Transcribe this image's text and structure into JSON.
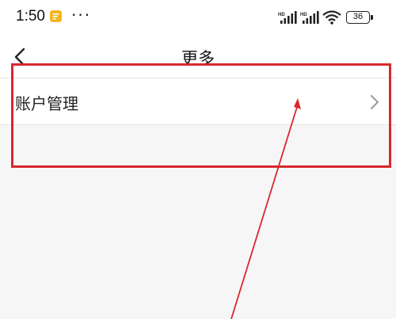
{
  "status_bar": {
    "time": "1:50",
    "battery_level": "36",
    "icons": [
      "app-notification-icon",
      "more-dots-icon",
      "hd-signal-icon",
      "hd-signal-icon",
      "wifi-icon",
      "battery-icon"
    ]
  },
  "nav": {
    "title": "更多",
    "back_icon": "chevron-left-icon"
  },
  "list": {
    "items": [
      {
        "label": "账户管理",
        "icon": "chevron-right-icon"
      }
    ]
  },
  "colors": {
    "annotation": "#d9272e",
    "background": "#f6f6f6",
    "surface": "#ffffff"
  }
}
